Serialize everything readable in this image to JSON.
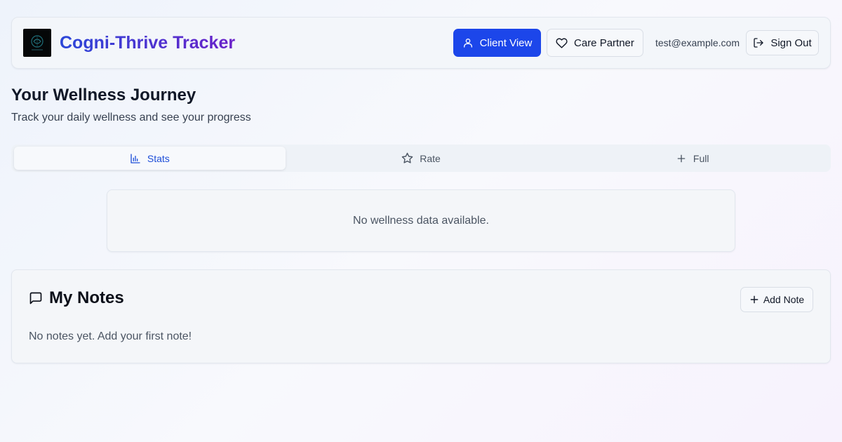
{
  "header": {
    "app_title": "Cogni-Thrive Tracker",
    "client_view_label": "Client View",
    "care_partner_label": "Care Partner",
    "user_email": "test@example.com",
    "sign_out_label": "Sign Out"
  },
  "page": {
    "title": "Your Wellness Journey",
    "subtitle": "Track your daily wellness and see your progress"
  },
  "tabs": [
    {
      "label": "Stats",
      "icon": "bar-chart-icon",
      "active": true
    },
    {
      "label": "Rate",
      "icon": "star-icon",
      "active": false
    },
    {
      "label": "Full",
      "icon": "plus-icon",
      "active": false
    }
  ],
  "stats": {
    "empty_message": "No wellness data available."
  },
  "notes": {
    "title": "My Notes",
    "add_note_label": "Add Note",
    "empty_message": "No notes yet. Add your first note!"
  },
  "colors": {
    "primary": "#1c46ea",
    "title_gradient_start": "#2b47d8",
    "title_gradient_end": "#6b21c9",
    "active_tab_text": "#1d4ed8"
  }
}
